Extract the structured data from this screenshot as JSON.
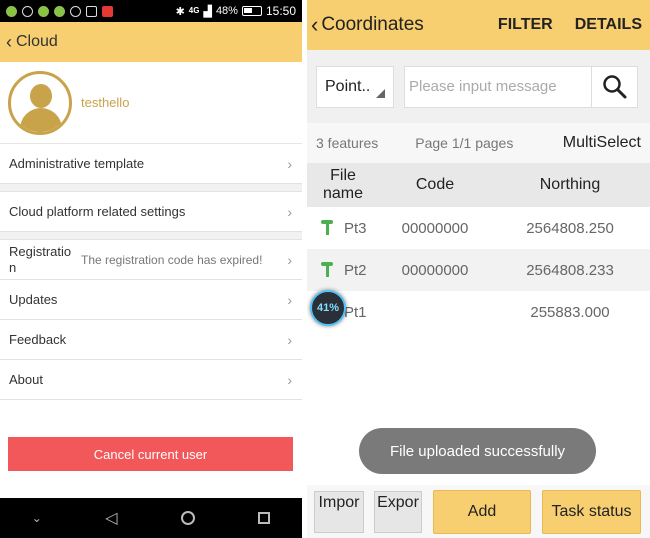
{
  "status_bar": {
    "battery": "48%",
    "time": "15:50",
    "network": "4G"
  },
  "cloud": {
    "title": "Cloud",
    "username": "testhello",
    "items": [
      {
        "label": "Administrative template"
      },
      {
        "label": "Cloud platform related settings"
      },
      {
        "label": "Registration",
        "value": "The registration code has expired!"
      },
      {
        "label": "Updates"
      },
      {
        "label": "Feedback"
      },
      {
        "label": "About"
      }
    ],
    "cancel_button": "Cancel current user",
    "accent_color": "#f8cf70",
    "danger_color": "#f2575a"
  },
  "coordinates": {
    "title": "Coordinates",
    "filter": "FILTER",
    "details": "DETAILS",
    "type_select": "Point..",
    "search_placeholder": "Please input message",
    "features": "3 features",
    "pages": "Page 1/1 pages",
    "multiselect": "MultiSelect",
    "columns": [
      "File name",
      "Code",
      "Northing"
    ],
    "rows": [
      {
        "name": "Pt3",
        "code": "00000000",
        "northing": "2564808.250"
      },
      {
        "name": "Pt2",
        "code": "00000000",
        "northing": "2564808.233"
      },
      {
        "name": "Pt1",
        "code": "",
        "northing": "255883.000"
      }
    ],
    "progress": "41%",
    "toast": "File uploaded successfully",
    "buttons": {
      "import": "Impor",
      "export": "Expor",
      "add": "Add",
      "task_status": "Task status"
    }
  }
}
